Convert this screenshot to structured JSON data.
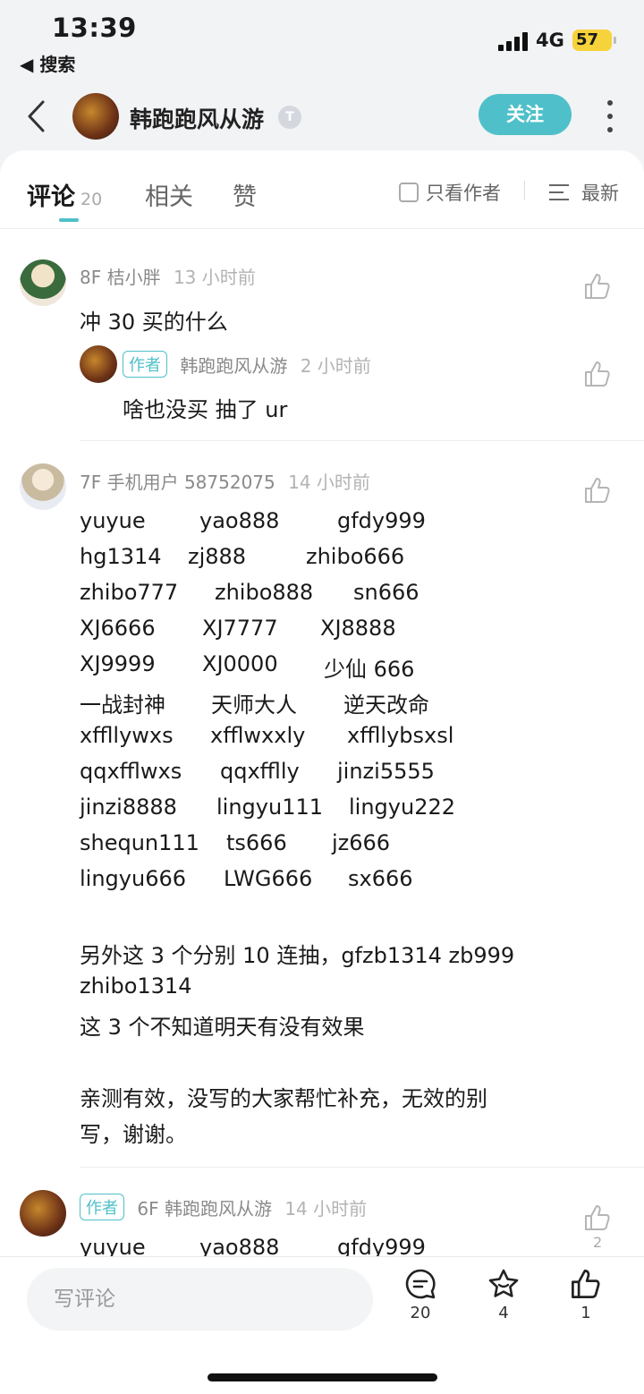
{
  "status_bar": {
    "time": "13:39",
    "back_app": "◀ 搜索",
    "network": "4G",
    "battery": "57"
  },
  "header": {
    "username": "韩跑跑风从游",
    "badge": "T",
    "follow_label": "关注"
  },
  "tabs": [
    {
      "label": "评论",
      "count": "20"
    },
    {
      "label": "相关"
    },
    {
      "label": "赞"
    }
  ],
  "filter": {
    "author_only_label": "只看作者",
    "sort_label": "最新"
  },
  "comments": [
    {
      "floor": "8F",
      "user": "桔小胖",
      "time": "13 小时前",
      "text": "冲 30 买的什么",
      "reply": {
        "tag": "作者",
        "user": "韩跑跑风从游",
        "time": "2 小时前",
        "text": "啥也没买 抽了 ur"
      }
    },
    {
      "floor": "7F",
      "user": "手机用户 58752075",
      "time": "14 小时前",
      "codes": [
        [
          "yuyue",
          "yao888",
          "gfdy999"
        ],
        [
          "hg1314",
          "zj888",
          "zhibo666"
        ],
        [
          "zhibo777",
          "zhibo888",
          "sn666"
        ],
        [
          "XJ6666",
          "XJ7777",
          "XJ8888"
        ],
        [
          "XJ9999",
          "XJ0000",
          "少仙 666"
        ],
        [
          "一战封神",
          "天师大人",
          "逆天改命"
        ],
        [
          "xffllywxs",
          "xfflwxxly",
          "xffllybsxsl"
        ],
        [
          "qqxfflwxs",
          "qqxfflly",
          "jinzi5555"
        ],
        [
          "jinzi8888",
          "lingyu111",
          "lingyu222"
        ],
        [
          "shequn111",
          "ts666",
          "jz666"
        ],
        [
          "lingyu666",
          "LWG666",
          "sx666"
        ]
      ],
      "extra_lines": [
        "另外这 3 个分别 10 连抽，gfzb1314    zb999",
        "zhibo1314",
        "这 3 个不知道明天有没有效果",
        "亲测有效，没写的大家帮忙补充，无效的别",
        "写，谢谢。"
      ]
    },
    {
      "tag": "作者",
      "floor": "6F",
      "user": "韩跑跑风从游",
      "time": "14 小时前",
      "likes": "2",
      "codes": [
        [
          "yuyue",
          "yao888",
          "gfdy999"
        ]
      ]
    }
  ],
  "bottom_bar": {
    "input_placeholder": "写评论",
    "comments_count": "20",
    "favorites_count": "4",
    "likes_count": "1"
  }
}
